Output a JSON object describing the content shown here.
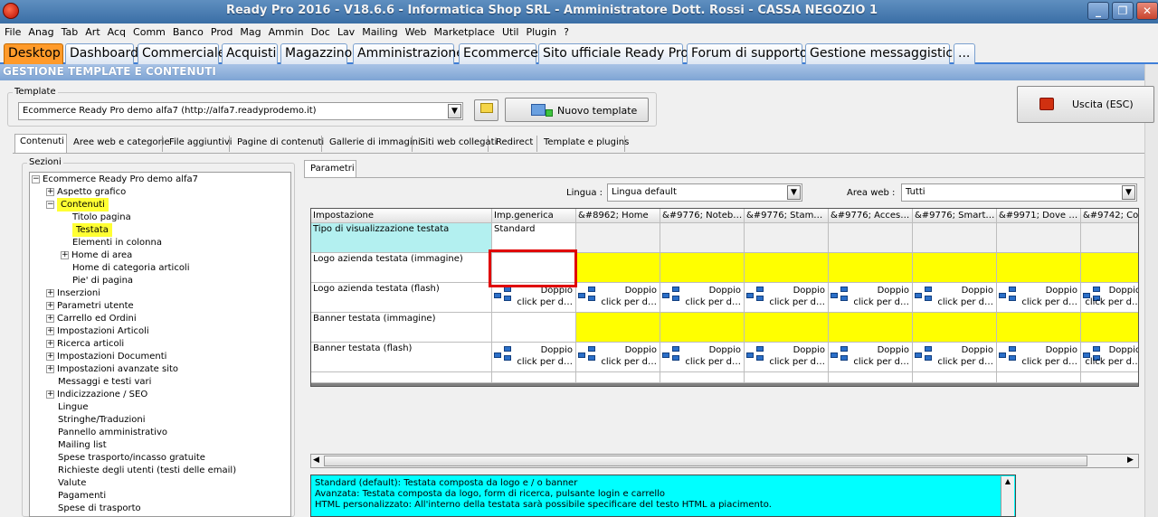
{
  "window": {
    "title": "Ready Pro 2016 - V18.6.6 - Informatica Shop SRL - Amministratore Dott. Rossi - CASSA NEGOZIO 1",
    "minimize": "_",
    "restore": "❐",
    "close": "✕"
  },
  "menu": [
    "File",
    "Anag",
    "Tab",
    "Art",
    "Acq",
    "Comm",
    "Banco",
    "Prod",
    "Mag",
    "Ammin",
    "Doc",
    "Lav",
    "Mailing",
    "Web",
    "Marketplace",
    "Util",
    "Plugin",
    "?"
  ],
  "main_tabs": [
    "Desktop",
    "Dashboard",
    "Commerciale",
    "Acquisti",
    "Magazzino",
    "Amministrazione",
    "Ecommerce",
    "Sito ufficiale Ready Pro",
    "Forum di supporto",
    "Gestione messaggistica",
    "..."
  ],
  "section_title": "GESTIONE TEMPLATE E CONTENUTI",
  "template": {
    "group_label": "Template",
    "selected": "Ecommerce Ready Pro demo alfa7 (http://alfa7.readyprodemo.it)",
    "new_button": "Nuovo template",
    "exit_button": "Uscita (ESC)"
  },
  "sub_tabs": [
    "Contenuti",
    "Aree web e categorie",
    "File aggiuntivi",
    "Pagine di contenuti",
    "Gallerie di immagini",
    "Siti web collegati",
    "Redirect",
    "Template e plugins"
  ],
  "sections_label": "Sezioni",
  "tree": [
    {
      "label": "Ecommerce Ready Pro demo alfa7",
      "box": "−"
    },
    {
      "label": "Aspetto grafico",
      "box": "+"
    },
    {
      "label": "Contenuti",
      "box": "−"
    },
    {
      "label": "Titolo pagina",
      "box": ""
    },
    {
      "label": "Testata",
      "box": ""
    },
    {
      "label": "Elementi in colonna",
      "box": ""
    },
    {
      "label": "Home di area",
      "box": "+"
    },
    {
      "label": "Home di categoria articoli",
      "box": ""
    },
    {
      "label": "Pie' di pagina",
      "box": ""
    },
    {
      "label": "Inserzioni",
      "box": "+"
    },
    {
      "label": "Parametri utente",
      "box": "+"
    },
    {
      "label": "Carrello ed Ordini",
      "box": "+"
    },
    {
      "label": "Impostazioni Articoli",
      "box": "+"
    },
    {
      "label": "Ricerca articoli",
      "box": "+"
    },
    {
      "label": "Impostazioni Documenti",
      "box": "+"
    },
    {
      "label": "Impostazioni avanzate sito",
      "box": "+"
    },
    {
      "label": "Messaggi e testi vari",
      "box": ""
    },
    {
      "label": "Indicizzazione / SEO",
      "box": "+"
    },
    {
      "label": "Lingue",
      "box": ""
    },
    {
      "label": "Stringhe/Traduzioni",
      "box": ""
    },
    {
      "label": "Pannello amministrativo",
      "box": ""
    },
    {
      "label": "Mailing list",
      "box": ""
    },
    {
      "label": "Spese trasporto/incasso gratuite",
      "box": ""
    },
    {
      "label": "Richieste degli utenti (testi delle email)",
      "box": ""
    },
    {
      "label": "Valute",
      "box": ""
    },
    {
      "label": "Pagamenti",
      "box": ""
    },
    {
      "label": "Spese di trasporto",
      "box": ""
    }
  ],
  "params": {
    "tab_label": "Parametri",
    "lingua_label": "Lingua :",
    "lingua_value": "Lingua default",
    "area_label": "Area web :",
    "area_value": "Tutti"
  },
  "grid": {
    "columns": [
      "Impostazione",
      "Imp.generica",
      "&#8962; Home",
      "&#9776; Noteb…",
      "&#9776; Stam…",
      "&#9776; Acces…",
      "&#9776; Smart…",
      "&#9971; Dove …",
      "&#9742; Co"
    ],
    "rows": [
      "Tipo di visualizzazione testata",
      "Logo azienda testata (immagine)",
      "Logo azienda testata (flash)",
      "Banner testata (immagine)",
      "Banner testata (flash)"
    ],
    "standard_value": "Standard",
    "flash_line1": "Doppio",
    "flash_line2": "click per d…"
  },
  "description": [
    "Standard (default): Testata composta da logo e / o banner",
    "Avanzata: Testata composta da logo, form di ricerca, pulsante login e carrello",
    "HTML personalizzato: All'interno della testata sarà possibile specificare del testo HTML a piacimento."
  ],
  "colors": {
    "highlight": "#ffff00",
    "active_tab": "#ff9a2a",
    "description_bg": "#00ffff",
    "marker": "#e00000"
  }
}
